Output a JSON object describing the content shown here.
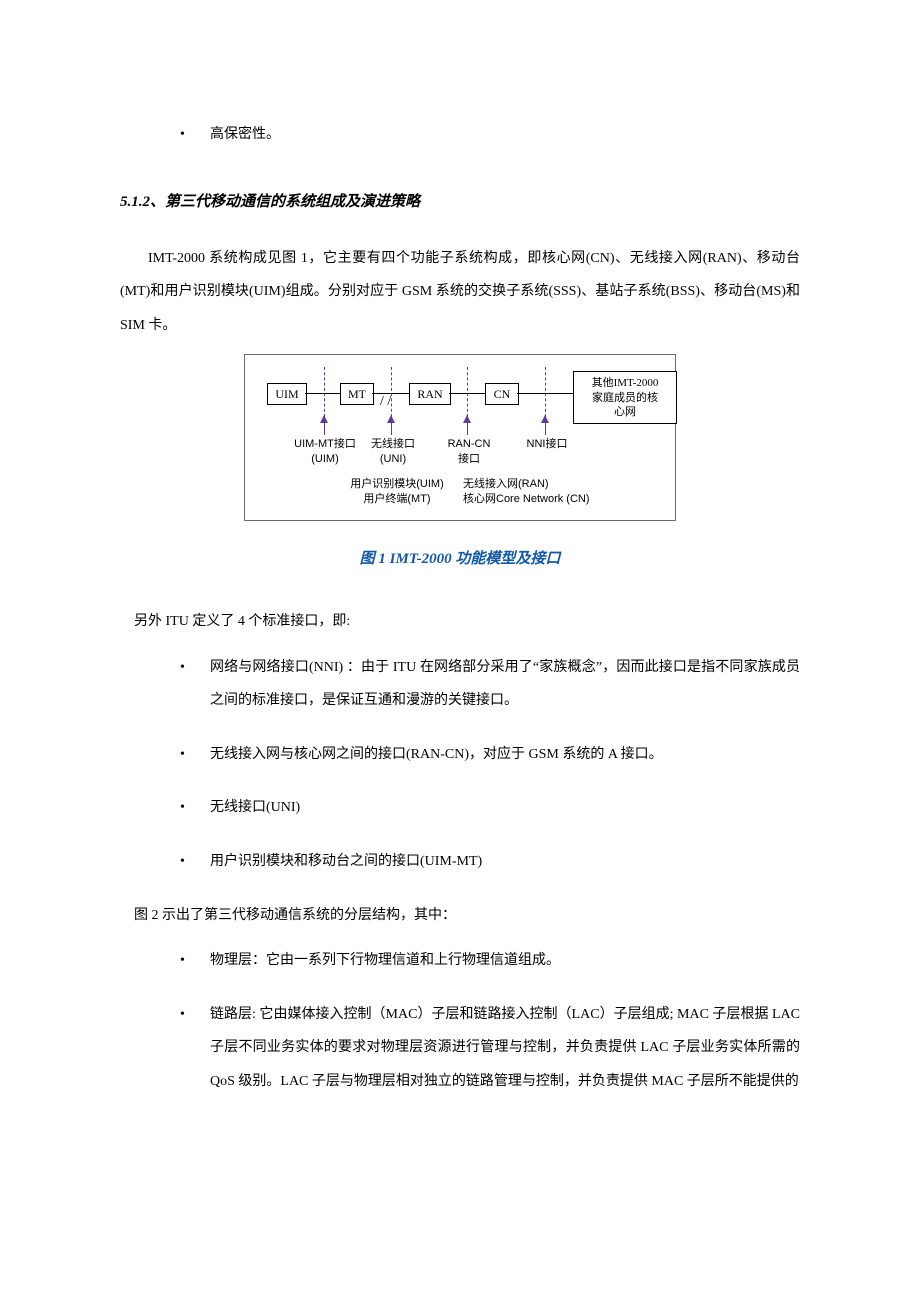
{
  "bullets_pre": [
    "高保密性。"
  ],
  "section_heading": "5.1.2、第三代移动通信的系统组成及演进策略",
  "para_1": "IMT-2000 系统构成见图 1，它主要有四个功能子系统构成，即核心网(CN)、无线接入网(RAN)、移动台(MT)和用户识别模块(UIM)组成。分别对应于 GSM 系统的交换子系统(SSS)、基站子系统(BSS)、移动台(MS)和SIM 卡。",
  "diagram": {
    "boxes": {
      "uim": "UIM",
      "mt": "MT",
      "ran": "RAN",
      "cn": "CN",
      "other": "其他IMT-2000\n家庭成员的核\n心网"
    },
    "interfaces": {
      "uim_mt": "UIM-MT接口\n(UIM)",
      "uni": "无线接口\n(UNI)",
      "ran_cn": "RAN-CN\n接口",
      "nni": "NNI接口"
    },
    "legend_left": "用户识别模块(UIM)\n用户终端(MT)",
    "legend_right": "无线接入网(RAN)\n核心网Core Network (CN)"
  },
  "figure_caption": "图 1 IMT-2000 功能模型及接口",
  "para_2": "另外 ITU 定义了 4 个标准接口，即:",
  "iface_list": [
    "网络与网络接口(NNI) ：由于 ITU 在网络部分采用了“家族概念”，因而此接口是指不同家族成员之间的标准接口，是保证互通和漫游的关键接口。",
    "无线接入网与核心网之间的接口(RAN-CN)，对应于 GSM 系统的 A 接口。",
    "无线接口(UNI)",
    "用户识别模块和移动台之间的接口(UIM-MT)"
  ],
  "para_3": "图 2 示出了第三代移动通信系统的分层结构，其中：",
  "layer_list": [
    "物理层：它由一系列下行物理信道和上行物理信道组成。",
    "链路层: 它由媒体接入控制（MAC）子层和链路接入控制（LAC）子层组成; MAC 子层根据 LAC子层不同业务实体的要求对物理层资源进行管理与控制，并负责提供 LAC 子层业务实体所需的QoS 级别。LAC 子层与物理层相对独立的链路管理与控制，并负责提供 MAC 子层所不能提供的"
  ]
}
